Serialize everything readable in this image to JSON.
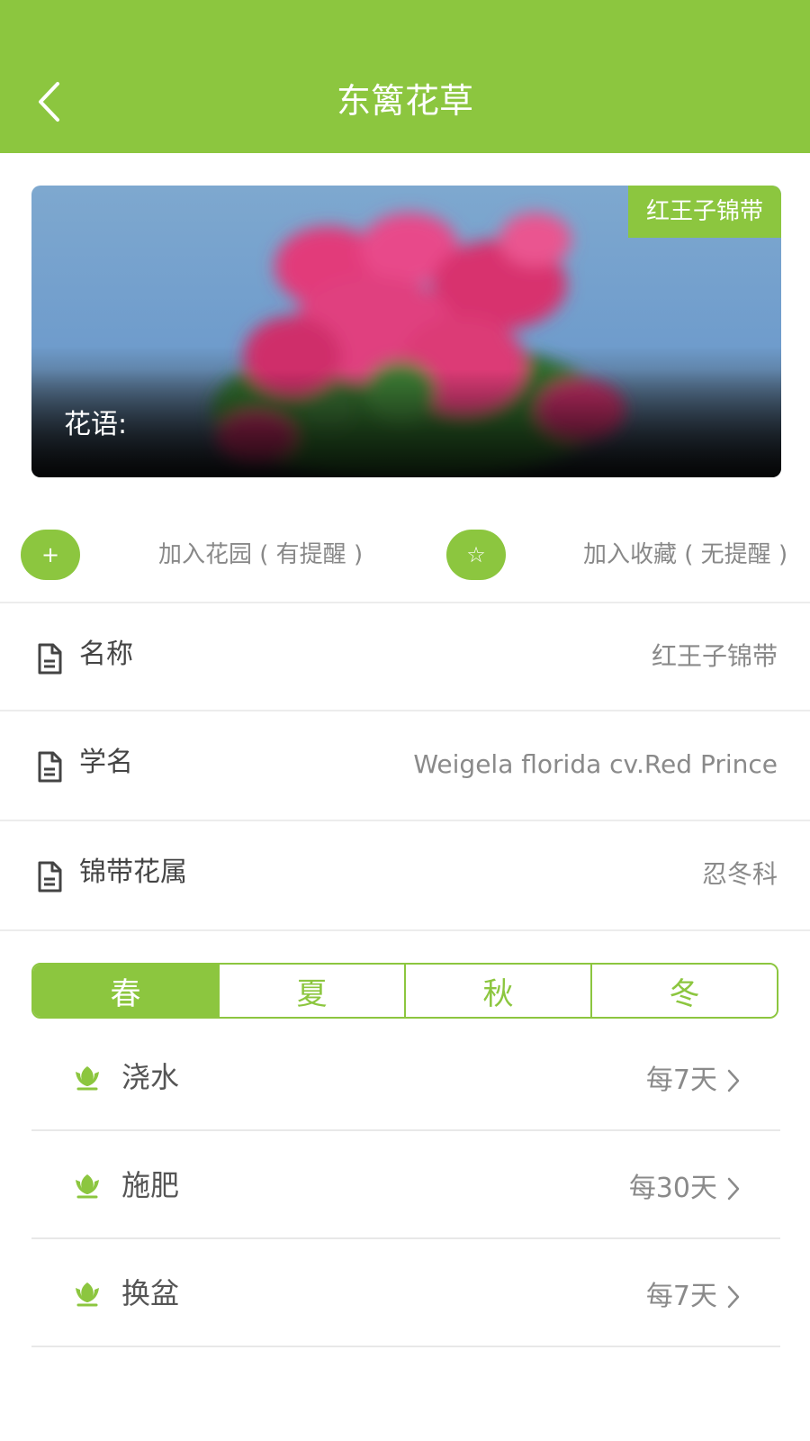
{
  "header": {
    "title": "东篱花草",
    "color": "#8cc63f"
  },
  "hero": {
    "tag": "红王子锦带",
    "caption": "花语:"
  },
  "actions": {
    "add_garden_icon": "+",
    "add_garden_label": "加入花园 ( 有提醒 )",
    "favorite_icon": "☆",
    "favorite_label": "加入收藏 ( 无提醒 )"
  },
  "info": [
    {
      "label": "名称",
      "value": "红王子锦带"
    },
    {
      "label": "学名",
      "value": "Weigela florida cv.Red Prince"
    },
    {
      "label": "锦带花属",
      "value": "忍冬科"
    }
  ],
  "seasons": {
    "tabs": [
      "春",
      "夏",
      "秋",
      "冬"
    ],
    "selected": "春"
  },
  "care": [
    {
      "label": "浇水",
      "value": "每7天"
    },
    {
      "label": "施肥",
      "value": "每30天"
    },
    {
      "label": "换盆",
      "value": "每7天"
    }
  ]
}
